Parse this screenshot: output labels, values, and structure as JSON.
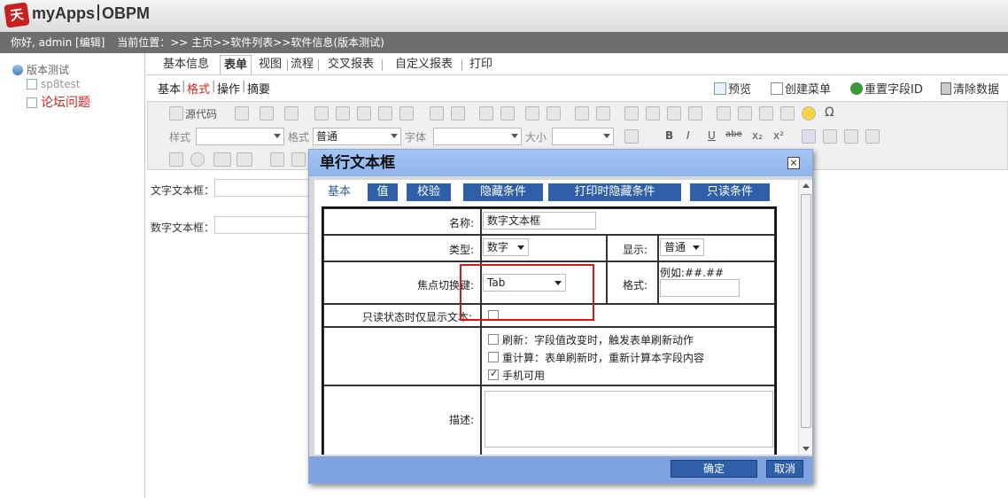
{
  "app": {
    "name": "myApps",
    "product": "OBPM",
    "logo_char": "天"
  },
  "infobar": {
    "greeting": "你好, admin [编辑]",
    "location": "当前位置：>> 主页>>软件列表>>软件信息(版本测试)"
  },
  "tree": {
    "root": "版本测试",
    "items": [
      "sp8test",
      "论坛问题"
    ]
  },
  "tabs": [
    "基本信息",
    "表单",
    "视图",
    "流程",
    "交叉报表",
    "自定义报表",
    "打印"
  ],
  "subtabs": [
    "基本",
    "格式",
    "操作",
    "摘要"
  ],
  "actions": [
    "预览",
    "创建菜单",
    "重置字段ID",
    "清除数据"
  ],
  "toolbar": {
    "source_label": "源代码",
    "style_label": "样式",
    "format_label": "格式",
    "format_value": "普通",
    "font_label": "字体",
    "size_label": "大小",
    "btn_b": "B",
    "btn_i": "I",
    "btn_u": "U",
    "btn_s": "abe",
    "btn_sub": "x₂",
    "btn_sup": "x²",
    "btn_omega": "Ω"
  },
  "form_fields": {
    "text_field": "文字文本框：",
    "number_field": "数字文本框："
  },
  "dialog": {
    "title": "单行文本框",
    "close": "×",
    "tabs": [
      "基本",
      "值",
      "校验",
      "隐藏条件",
      "打印时隐藏条件",
      "只读条件"
    ],
    "name_label": "名称:",
    "name_value": "数字文本框",
    "type_label": "类型:",
    "type_value": "数字",
    "display_label": "显示:",
    "display_value": "普通",
    "focus_label": "焦点切换键:",
    "focus_value": "Tab",
    "format_label": "格式:",
    "format_hint": "例如:##.##",
    "readonly_label": "只读状态时仅显示文本:",
    "options": [
      {
        "label": "刷新：字段值改变时，触发表单刷新动作",
        "checked": false
      },
      {
        "label": "重计算：表单刷新时，重新计算本字段内容",
        "checked": false
      },
      {
        "label": "手机可用",
        "checked": true
      }
    ],
    "desc_label": "描述:",
    "ok": "确定",
    "cancel": "取消"
  },
  "colors": {
    "accent": "#2f5fa8",
    "title_bg": "#a5c6f5",
    "footer_bg": "#7ea3e0",
    "highlight": "#d21b1b",
    "active_subtab": "#d0261c"
  }
}
